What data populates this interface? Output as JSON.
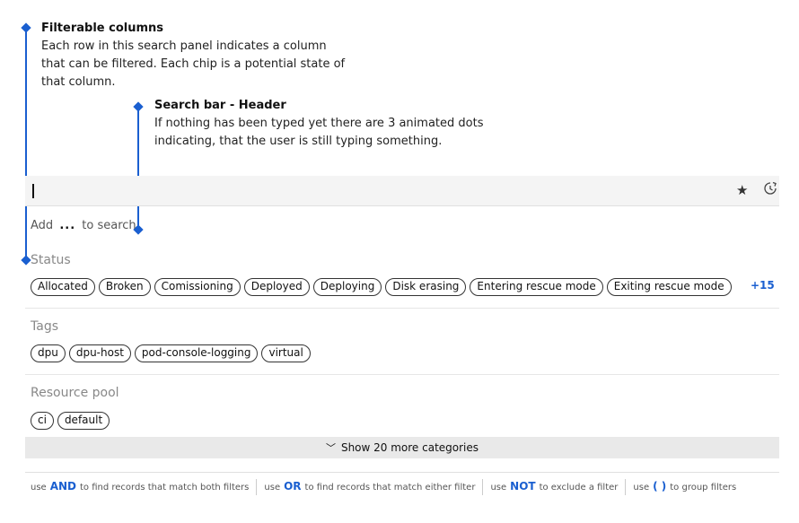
{
  "annotations": {
    "filterable": {
      "title": "Filterable columns",
      "description": "Each row in this search panel indicates a column that can be filtered. Each chip is a potential state of that column."
    },
    "search_header": {
      "title": "Search bar - Header",
      "description": "If nothing has been typed yet there are 3 animated dots indicating, that the user is still typing something."
    }
  },
  "search": {
    "add_prefix": "Add",
    "dots": "...",
    "add_suffix": "to search",
    "icons": [
      "star-icon",
      "clock-icon"
    ]
  },
  "sections": {
    "status": {
      "title": "Status",
      "chips": [
        "Allocated",
        "Broken",
        "Comissioning",
        "Deployed",
        "Deploying",
        "Disk erasing",
        "Entering rescue mode",
        "Exiting rescue mode"
      ],
      "more": "+15"
    },
    "tags": {
      "title": "Tags",
      "chips": [
        "dpu",
        "dpu-host",
        "pod-console-logging",
        "virtual"
      ]
    },
    "resource_pool": {
      "title": "Resource pool",
      "chips": [
        "ci",
        "default"
      ]
    }
  },
  "show_more": {
    "label": "Show 20 more categories",
    "icon": "chevron-down-icon"
  },
  "footer": {
    "items": [
      {
        "pre": "use",
        "kw": "AND",
        "post": "to find records that match both filters"
      },
      {
        "pre": "use",
        "kw": "OR",
        "post": "to find records that match either filter"
      },
      {
        "pre": "use",
        "kw": "NOT",
        "post": "to exclude a filter"
      },
      {
        "pre": "use",
        "kw": "( )",
        "post": "to group filters"
      }
    ]
  },
  "colors": {
    "accent": "#1a5fd0",
    "bar_bg": "#f4f4f4",
    "show_more_bg": "#e9e9e9"
  }
}
